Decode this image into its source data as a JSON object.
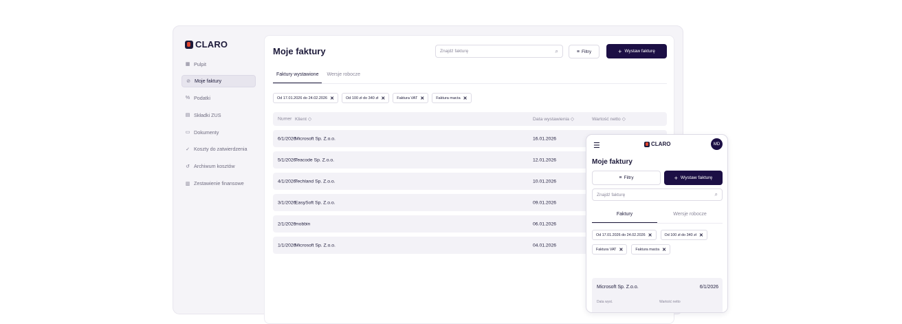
{
  "brand": {
    "name": "CLARO",
    "accent": "#1c0f45",
    "logo_red": "#e2452f"
  },
  "sidebar": {
    "items": [
      {
        "icon": "grid-icon",
        "glyph": "▦",
        "label": "Pulpit"
      },
      {
        "icon": "invoice-icon",
        "glyph": "⊘",
        "label": "Moje faktury",
        "active": true
      },
      {
        "icon": "percent-icon",
        "glyph": "%",
        "label": "Podatki"
      },
      {
        "icon": "calculator-icon",
        "glyph": "▤",
        "label": "Składki ZUS"
      },
      {
        "icon": "document-icon",
        "glyph": "▭",
        "label": "Dokumenty"
      },
      {
        "icon": "check-icon",
        "glyph": "✓",
        "label": "Koszty do zatwierdzenia"
      },
      {
        "icon": "history-icon",
        "glyph": "↺",
        "label": "Archiwum kosztów"
      },
      {
        "icon": "chart-icon",
        "glyph": "▥",
        "label": "Zestawienie finansowe"
      }
    ]
  },
  "main": {
    "title": "Moje faktury",
    "search_placeholder": "Znajdź fakturę",
    "filter_label": "Filtry",
    "primary_label": "Wystaw fakturę",
    "tabs": [
      {
        "label": "Faktury wystawione",
        "active": true
      },
      {
        "label": "Wersje robocze"
      }
    ],
    "chips": [
      "Od 17.01.2026 do 24.02.2026",
      "Od 100 zł do 340 zł",
      "Faktura VAT",
      "Faktura marża"
    ],
    "table": {
      "headers": [
        "Numer",
        "Klient ◇",
        "Data wystawienia ◇",
        "Wartość netto ◇"
      ],
      "rows": [
        {
          "number": "6/1/2026",
          "client": "Microsoft Sp. Z.o.o.",
          "date": "16.01.2026"
        },
        {
          "number": "5/1/2026",
          "client": "Teacode Sp. Z.o.o.",
          "date": "12.01.2026"
        },
        {
          "number": "4/1/2026",
          "client": "Techland Sp. Z.o.o.",
          "date": "10.01.2026"
        },
        {
          "number": "3/1/2026",
          "client": "EasySoft Sp. Z.o.o.",
          "date": "09.01.2026"
        },
        {
          "number": "2/1/2026",
          "client": "mobbin",
          "date": "06.01.2026"
        },
        {
          "number": "1/1/2026",
          "client": "Microsoft Sp. Z.o.o.",
          "date": "04.01.2026"
        }
      ]
    }
  },
  "mobile": {
    "avatar": "MD",
    "title": "Moje faktury",
    "filter_label": "Filtry",
    "primary_label": "Wystaw fakturę",
    "search_placeholder": "Znajdź fakturę",
    "tabs": [
      {
        "label": "Faktury",
        "active": true
      },
      {
        "label": "Wersje robocze"
      }
    ],
    "chips": [
      "Od 17.01.2026 do 24.02.2026",
      "Od 100 zł do 340 zł",
      "Faktura VAT",
      "Faktura marża"
    ],
    "card": {
      "client": "Microsoft Sp. Z.o.o.",
      "number": "6/1/2026",
      "date_label": "Data wyst.",
      "value_label": "Wartość netto"
    }
  }
}
